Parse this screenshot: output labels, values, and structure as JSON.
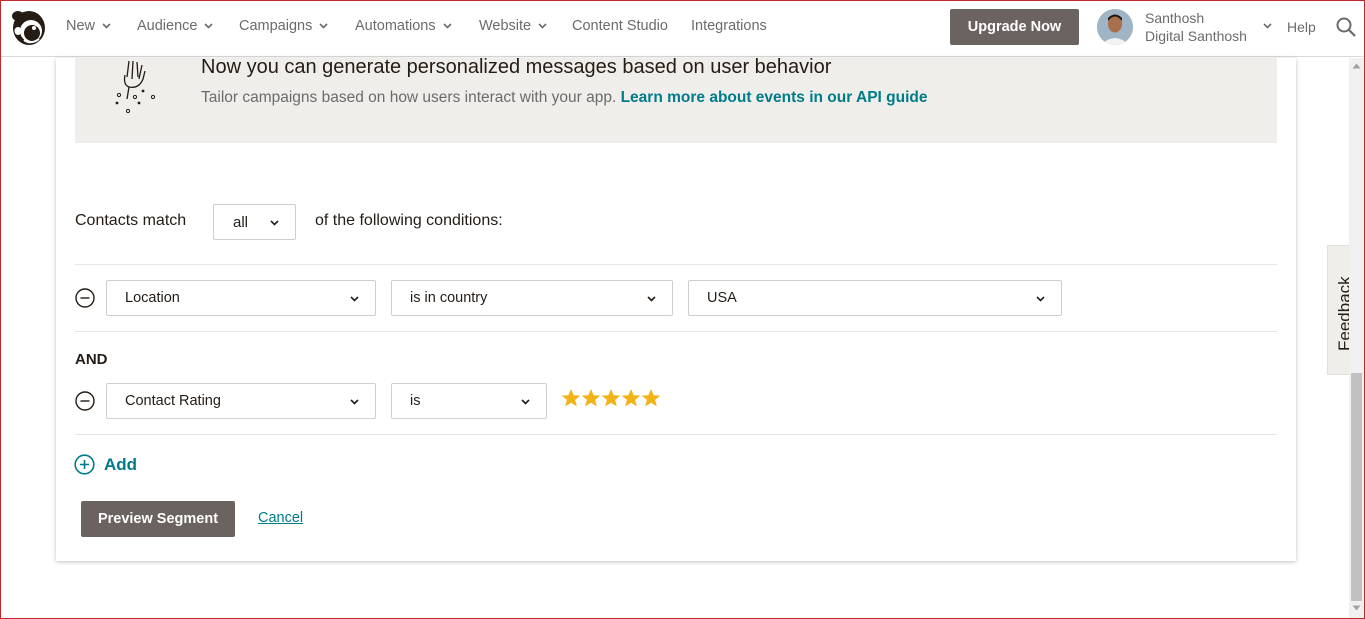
{
  "nav": {
    "items": [
      {
        "label": "New",
        "has_dropdown": true
      },
      {
        "label": "Audience",
        "has_dropdown": true
      },
      {
        "label": "Campaigns",
        "has_dropdown": true
      },
      {
        "label": "Automations",
        "has_dropdown": true
      },
      {
        "label": "Website",
        "has_dropdown": true
      },
      {
        "label": "Content Studio",
        "has_dropdown": false
      },
      {
        "label": "Integrations",
        "has_dropdown": false
      }
    ],
    "upgrade_label": "Upgrade Now",
    "user": {
      "name": "Santhosh",
      "org": "Digital Santhosh"
    },
    "help_label": "Help",
    "icons": {
      "logo": "mailchimp-logo-icon",
      "search": "search-icon"
    }
  },
  "feedback": {
    "label": "Feedback"
  },
  "banner": {
    "title": "Now you can generate personalized messages based on user behavior",
    "text": "Tailor campaigns based on how users interact with your app.",
    "link": "Learn more about events in our API guide"
  },
  "segment": {
    "match_prefix": "Contacts match",
    "match_value": "all",
    "match_suffix": "of the following conditions:",
    "conditions": [
      {
        "field": "Location",
        "operator": "is in country",
        "value": "USA"
      },
      {
        "field": "Contact Rating",
        "operator": "is",
        "rating": 5,
        "rating_max": 5
      }
    ],
    "joiner": "AND",
    "add_label": "Add",
    "preview_label": "Preview Segment",
    "cancel_label": "Cancel"
  },
  "colors": {
    "accent": "#007c89",
    "button": "#6b6360",
    "banner_bg": "#efeeea",
    "star": "#f2b318"
  }
}
